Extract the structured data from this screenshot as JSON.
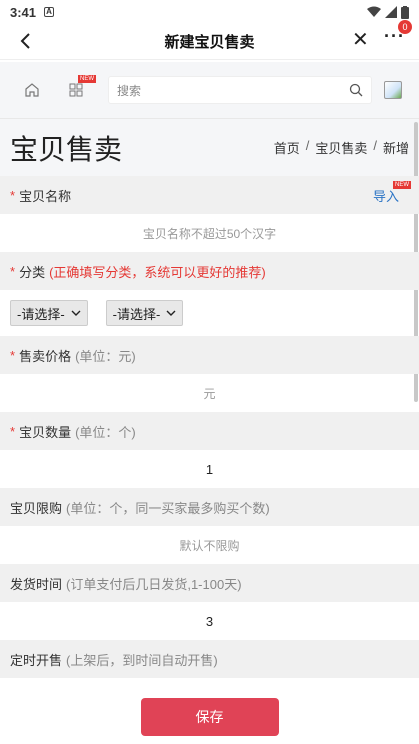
{
  "status": {
    "time": "3:41",
    "app_icon_letter": "A"
  },
  "navbar": {
    "title": "新建宝贝售卖",
    "badge": "0"
  },
  "topbar": {
    "new_tag": "NEW",
    "search_placeholder": "搜索"
  },
  "page": {
    "heading": "宝贝售卖",
    "breadcrumb": [
      "首页",
      "宝贝售卖",
      "新增"
    ]
  },
  "form": {
    "name": {
      "required": "*",
      "label": "宝贝名称",
      "import_label": "导入",
      "import_tag": "NEW",
      "placeholder": "宝贝名称不超过50个汉字"
    },
    "category": {
      "required": "*",
      "label": "分类",
      "hint": "(正确填写分类，系统可以更好的推荐)",
      "select1": "-请选择-",
      "select2": "-请选择-"
    },
    "price": {
      "required": "*",
      "label": "售卖价格",
      "hint": "(单位：元)",
      "placeholder": "元"
    },
    "quantity": {
      "required": "*",
      "label": "宝贝数量",
      "hint": "(单位：个)",
      "value": "1"
    },
    "limit": {
      "label": "宝贝限购",
      "hint": "(单位：个，同一买家最多购买个数)",
      "placeholder": "默认不限购"
    },
    "ship": {
      "label": "发货时间",
      "hint": "(订单支付后几日发货,1-100天)",
      "value": "3"
    },
    "timed": {
      "label": "定时开售",
      "hint": "(上架后，到时间自动开售)"
    }
  },
  "footer": {
    "save_label": "保存"
  },
  "colors": {
    "accent": "#e04356",
    "required": "#e53935",
    "link": "#2a73c5"
  }
}
